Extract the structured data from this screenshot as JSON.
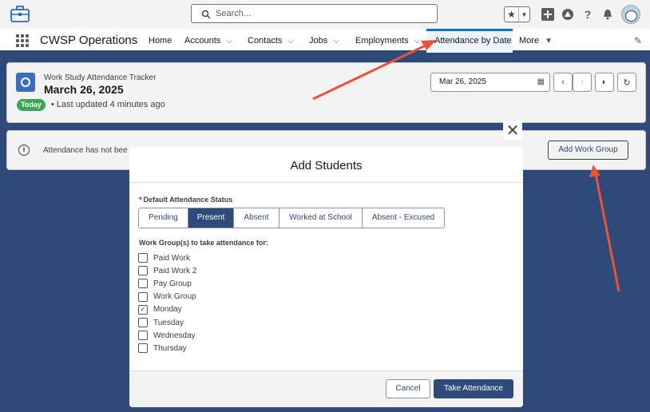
{
  "header": {
    "search_placeholder": "Search..."
  },
  "nav": {
    "app_name": "CWSP Operations",
    "items": [
      {
        "label": "Home"
      },
      {
        "label": "Accounts"
      },
      {
        "label": "Contacts"
      },
      {
        "label": "Jobs"
      },
      {
        "label": "Employments"
      },
      {
        "label": "Attendance by Date"
      },
      {
        "label": "More"
      }
    ],
    "active_item": "Attendance by Date"
  },
  "tracker": {
    "subtitle": "Work Study Attendance Tracker",
    "date": "March 26, 2025",
    "badge": "Today",
    "updated": "Last updated 4 minutes ago",
    "date_input_value": "Mar 26, 2025"
  },
  "notice": {
    "text": "Attendance has not bee",
    "add_button": "Add Work Group"
  },
  "modal": {
    "title": "Add Students",
    "status_label": "Default Attendance Status",
    "status_options": [
      "Pending",
      "Present",
      "Absent",
      "Worked at School",
      "Absent - Excused"
    ],
    "status_selected": "Present",
    "groups_label": "Work Group(s) to take attendance for:",
    "groups": [
      {
        "label": "Paid Work",
        "checked": false
      },
      {
        "label": "Paid Work 2",
        "checked": false
      },
      {
        "label": "Pay Group",
        "checked": false
      },
      {
        "label": "Work Group",
        "checked": false
      },
      {
        "label": "Monday",
        "checked": true
      },
      {
        "label": "Tuesday",
        "checked": false
      },
      {
        "label": "Wednesday",
        "checked": false
      },
      {
        "label": "Thursday",
        "checked": false
      }
    ],
    "cancel_button": "Cancel",
    "submit_button": "Take Attendance"
  },
  "colors": {
    "brand_dark": "#2d4a7a",
    "active_tab": "#0176d3",
    "today_badge": "#3ba755",
    "annotation_arrow": "#e8543a"
  }
}
